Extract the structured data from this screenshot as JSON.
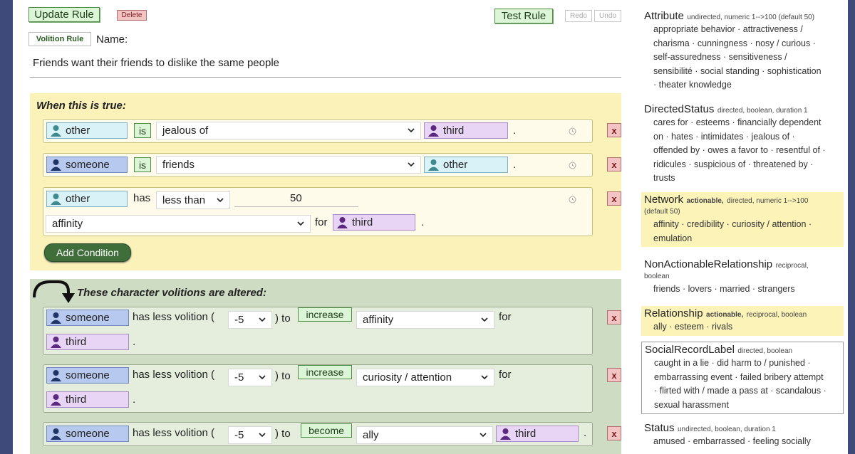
{
  "toolbar": {
    "update_label": "Update Rule",
    "delete_label": "Delete",
    "test_label": "Test Rule",
    "redo_label": "Redo",
    "undo_label": "Undo"
  },
  "rule": {
    "type_label": "Volition Rule",
    "name_label": "Name:",
    "name_value": "Friends want their friends to dislike the same people"
  },
  "conditions": {
    "heading": "When this is true:",
    "add_label": "Add Condition",
    "rows": [
      {
        "subject": "other",
        "verb": "is",
        "predicate": "jealous of",
        "object": "third",
        "dot": "."
      },
      {
        "subject": "someone",
        "verb": "is",
        "predicate": "friends",
        "object": "other",
        "dot": "."
      },
      {
        "subject": "other",
        "verb": "has",
        "comparator": "less than",
        "value": "50",
        "predicate": "affinity",
        "for": "for",
        "object": "third",
        "dot": "."
      }
    ]
  },
  "effects": {
    "heading": "These character volitions are altered:",
    "rows": [
      {
        "subject": "someone",
        "text": "has less volition (",
        "amount": "-5",
        "to": ") to",
        "action": "increase",
        "predicate": "affinity",
        "for": "for",
        "object": "third",
        "dot": "."
      },
      {
        "subject": "someone",
        "text": "has less volition (",
        "amount": "-5",
        "to": ") to",
        "action": "increase",
        "predicate": "curiosity / attention",
        "for": "for",
        "object": "third",
        "dot": "."
      },
      {
        "subject": "someone",
        "text": "has less volition (",
        "amount": "-5",
        "to": ") to",
        "action": "become",
        "predicate": "ally",
        "object": "third",
        "dot": "."
      }
    ]
  },
  "x_label": "x",
  "sidebar": [
    {
      "name": "Attribute",
      "meta": "undirected, numeric 1-->100 (default 50)",
      "values": [
        "appropriate behavior · attractiveness /",
        "charisma · cunningness · nosy / curious ·",
        "self-assuredness · sensitiveness /",
        "sensibilité · social standing · sophistication",
        "· theater knowledge"
      ]
    },
    {
      "name": "DirectedStatus",
      "meta": "directed, boolean, duration 1",
      "values": [
        "cares for · esteems · financially dependent",
        "on · hates · intimidates · jealous of ·",
        "offended by · owes a favor to · resentful of ·",
        "ridicules · suspicious of · threatened by ·",
        "trusts"
      ]
    },
    {
      "name": "Network",
      "meta_bold": "actionable,",
      "meta": "directed, numeric 1-->100",
      "meta2": "(default 50)",
      "values": [
        "affinity · credibility · curiosity / attention ·",
        "emulation"
      ]
    },
    {
      "name": "NonActionableRelationship",
      "meta": "reciprocal,",
      "meta2": "boolean",
      "values": [
        "friends · lovers · married · strangers"
      ]
    },
    {
      "name": "Relationship",
      "meta_bold": "actionable,",
      "meta": "reciprocal, boolean",
      "values": [
        "ally · esteem · rivals"
      ]
    },
    {
      "name": "SocialRecordLabel",
      "meta": "directed, boolean",
      "values": [
        "caught in a lie · did harm to / punished ·",
        "embarrassing event · failed bribery attempt",
        "· flirted with / made a pass at · scandalous ·",
        "sexual harassment"
      ]
    },
    {
      "name": "Status",
      "meta": "undirected, boolean, duration 1",
      "values": [
        "amused · embarrassed · feeling socially"
      ]
    }
  ],
  "colors": {
    "conditions_bg": "#fbf2b9",
    "effects_bg": "#cfdcc4",
    "other_chip": "#d9f2f8",
    "someone_chip": "#b8c9ef",
    "third_chip": "#e8d4f5"
  }
}
